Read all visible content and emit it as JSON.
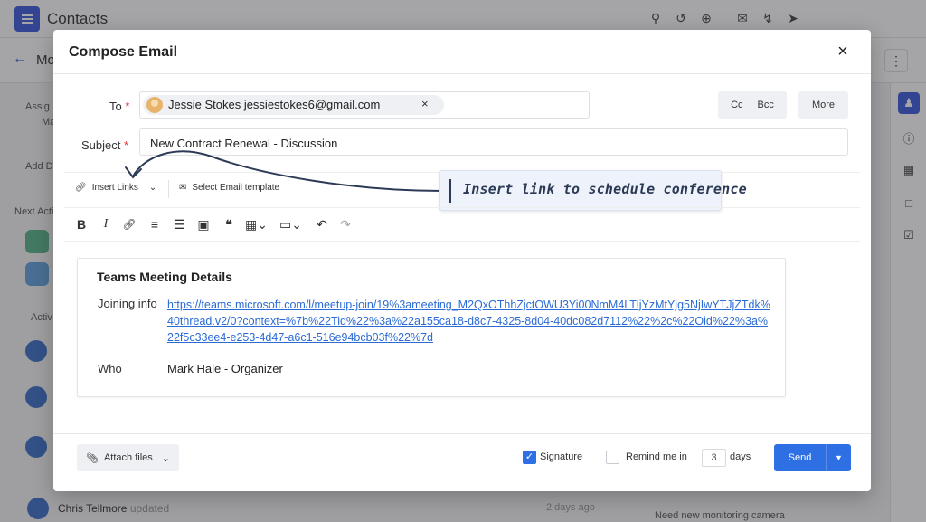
{
  "app": {
    "title": "Contacts",
    "breadcrumb": "Mo",
    "left_labels": [
      "Assig",
      "Ma",
      "Add D",
      "Next Acti",
      "Activ"
    ],
    "feed": {
      "name": "Chris Tellmore",
      "action": "updated",
      "time": "2 days ago",
      "right_snippet": "Need new monitoring camera"
    }
  },
  "modal": {
    "title": "Compose Email",
    "close_icon": "×",
    "to": {
      "label": "To",
      "required_mark": "*",
      "recipient": "Jessie Stokes jessiestokes6@gmail.com",
      "remove_icon": "×",
      "cc_label": "Cc",
      "bcc_label": "Bcc",
      "more_label": "More"
    },
    "subject": {
      "label": "Subject",
      "required_mark": "*",
      "value": "New Contract Renewal - Discussion"
    },
    "insert_tools": {
      "insert_links_label": "Insert Links",
      "select_template_label": "Select Email template"
    },
    "callout": "Insert link to schedule conference",
    "format_tools": [
      "bold",
      "italic",
      "link",
      "bullet-list",
      "numbered-list",
      "image",
      "quote",
      "table",
      "video",
      "undo",
      "redo"
    ],
    "editor": {
      "card_title": "Teams Meeting Details",
      "joining_label": "Joining info",
      "joining_link": "https://teams.microsoft.com/l/meetup-join/19%3ameeting_M2QxOThhZjctOWU3Yi00NmM4LTljYzMtYjg5NjIwYTJjZTdk%40thread.v2/0?context=%7b%22Tid%22%3a%22a155ca18-d8c7-4325-8d04-40dc082d7112%22%2c%22Oid%22%3a%22f5c33ee4-e253-4d47-a6c1-516e94bcb03f%22%7d",
      "who_label": "Who",
      "who_value": "Mark Hale - Organizer"
    },
    "footer": {
      "attach_label": "Attach files",
      "signature_label": "Signature",
      "signature_checked": true,
      "remind_label": "Remind me in",
      "remind_checked": false,
      "remind_days": "3",
      "days_label": "days",
      "send_label": "Send"
    }
  },
  "colors": {
    "primary": "#2f6fe4",
    "brand": "#3b5bdb",
    "link": "#2a6bd6",
    "callout_bg": "#eef3fb",
    "callout_text": "#2d3a56"
  }
}
